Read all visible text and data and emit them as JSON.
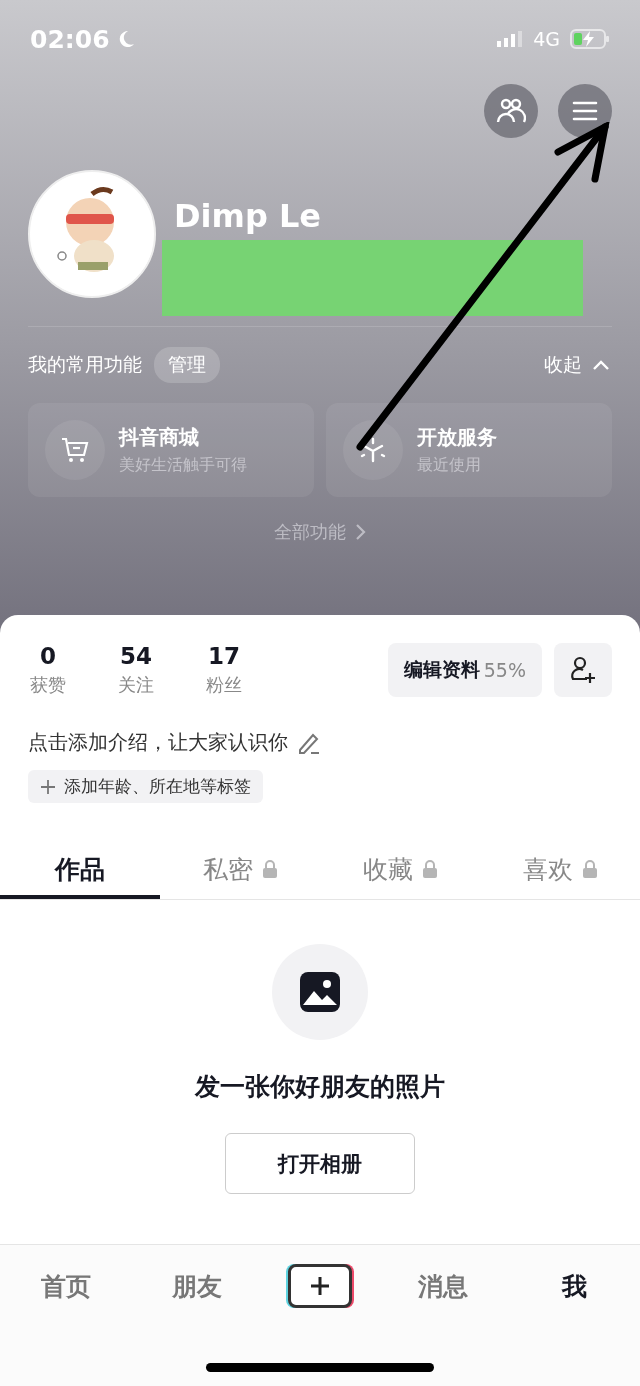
{
  "status_bar": {
    "time": "02:06",
    "network": "4G"
  },
  "profile": {
    "name": "Dimp Le"
  },
  "shortcuts": {
    "title": "我的常用功能",
    "manage": "管理",
    "collapse": "收起",
    "all": "全部功能",
    "items": [
      {
        "kind": "cart",
        "title": "抖音商城",
        "subtitle": "美好生活触手可得"
      },
      {
        "kind": "spark",
        "title": "开放服务",
        "subtitle": "最近使用"
      }
    ]
  },
  "stats": [
    {
      "value": "0",
      "label": "获赞"
    },
    {
      "value": "54",
      "label": "关注"
    },
    {
      "value": "17",
      "label": "粉丝"
    }
  ],
  "edit_profile": {
    "label": "编辑资料",
    "percent": "55%"
  },
  "bio": "点击添加介绍，让大家认识你",
  "tag_button": "添加年龄、所在地等标签",
  "tabs": [
    {
      "label": "作品",
      "selected": true,
      "locked": false
    },
    {
      "label": "私密",
      "selected": false,
      "locked": true
    },
    {
      "label": "收藏",
      "selected": false,
      "locked": true
    },
    {
      "label": "喜欢",
      "selected": false,
      "locked": true
    }
  ],
  "empty_state": {
    "message": "发一张你好朋友的照片",
    "button": "打开相册"
  },
  "bottom_nav": [
    {
      "kind": "text",
      "label": "首页",
      "selected": false
    },
    {
      "kind": "text",
      "label": "朋友",
      "selected": false
    },
    {
      "kind": "create",
      "selected": false
    },
    {
      "kind": "text",
      "label": "消息",
      "selected": false
    },
    {
      "kind": "text",
      "label": "我",
      "selected": true
    }
  ]
}
